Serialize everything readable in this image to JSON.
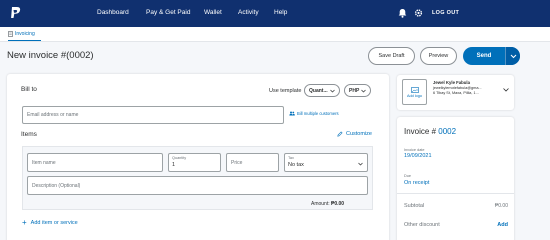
{
  "nav": {
    "items": [
      "Dashboard",
      "Pay & Get Paid",
      "Wallet",
      "Activity",
      "Help"
    ],
    "logout": "LOG OUT",
    "icons": [
      "bell-icon",
      "gear-icon",
      "user-icon"
    ]
  },
  "subnav": {
    "invoicing": "Invoicing"
  },
  "header": {
    "title": "New invoice #(0002)",
    "save_draft": "Save Draft",
    "preview": "Preview",
    "send": "Send"
  },
  "bill_to": {
    "label": "Bill to",
    "use_template": "Use template",
    "template_value": "Quant...",
    "currency_value": "PHP",
    "email_placeholder": "Email address or name",
    "bill_multiple": "Bill multiple customers"
  },
  "items": {
    "label": "Items",
    "customize": "Customize",
    "item_name_placeholder": "Item name",
    "quantity_label": "Quantity",
    "quantity_value": "1",
    "price_placeholder": "Price",
    "tax_label": "Tax",
    "tax_value": "No tax",
    "description_placeholder": "Description (Optional)",
    "amount_label": "Amount:",
    "amount_value": "₱0.00",
    "add_item": "Add item or service"
  },
  "business": {
    "add_logo": "Add logo",
    "name": "Jewel Kyle Fabula",
    "email": "jewelkylemotefabula@gma...",
    "address": "6 Tibay St, Maxa, Pilila, 1..."
  },
  "invoice_meta": {
    "invoice_label": "Invoice #",
    "invoice_number": "0002",
    "date_label": "Invoice date",
    "date_value": "19/09/2021",
    "due_label": "Due",
    "due_value": "On receipt",
    "subtotal_label": "Subtotal",
    "subtotal_value": "₱0.00",
    "discount_label": "Other discount",
    "discount_action": "Add"
  },
  "colors": {
    "nav_bg": "#10306f",
    "accent": "#0070ba"
  }
}
